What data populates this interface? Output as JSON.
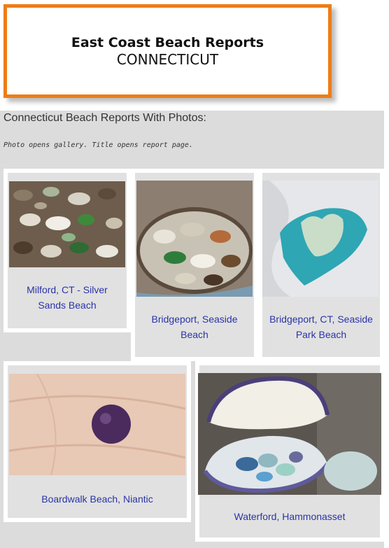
{
  "header": {
    "title": "East Coast Beach Reports",
    "subtitle": "CONNECTICUT"
  },
  "gallery": {
    "heading": "Connecticut Beach Reports With Photos:",
    "note": "Photo opens gallery. Title opens report page.",
    "items": [
      {
        "line1": "Milford, CT - Silver",
        "line2": "Sands Beach",
        "photo": "sea-glass-pile"
      },
      {
        "line1": "Bridgeport, Seaside",
        "line2": "Beach",
        "photo": "sea-glass-bowl"
      },
      {
        "line1": "Bridgeport, CT, Seaside",
        "line2": "Park Beach",
        "photo": "heart-sea-glass"
      },
      {
        "line1": "Boardwalk Beach, Niantic",
        "line2": "",
        "photo": "purple-marble-on-palm"
      },
      {
        "line1": "Waterford, Hammonasset",
        "line2": "",
        "photo": "sea-glass-in-shell"
      }
    ]
  },
  "colors": {
    "accent_border": "#ee7d16",
    "link": "#2a34a8",
    "panel": "#dcdcdc"
  }
}
